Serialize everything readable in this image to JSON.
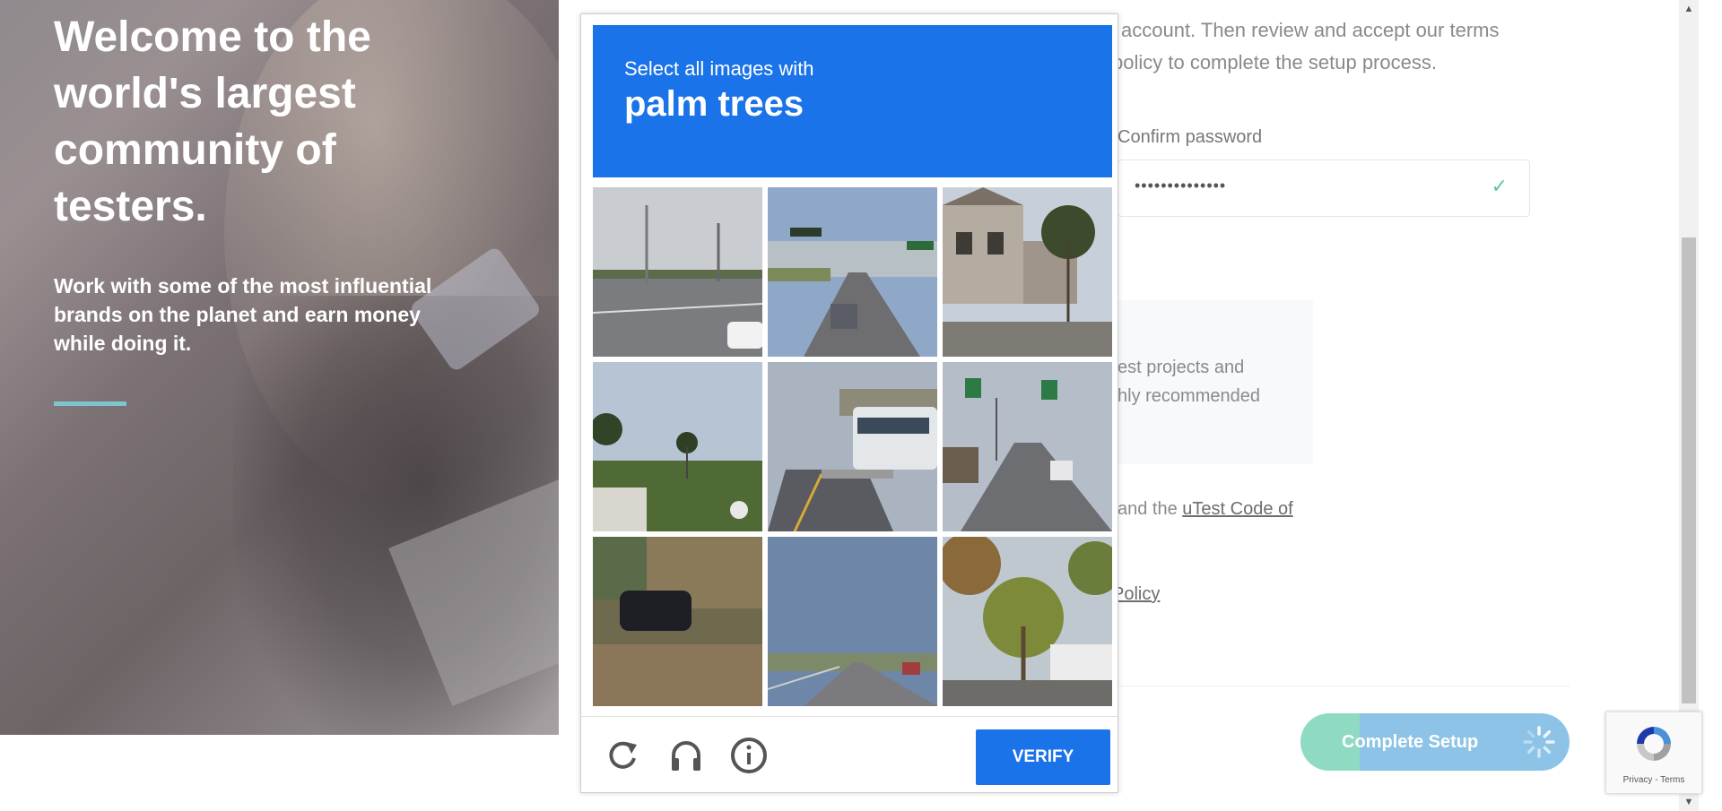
{
  "hero": {
    "title": "Welcome to the world's largest community of testers.",
    "subtitle": "Work with some of the most influential brands on the planet and earn money while doing it."
  },
  "form": {
    "intro_line1": "account. Then review and accept our terms",
    "intro_line2": "policy to complete the setup process.",
    "confirm_label": "Confirm password",
    "confirm_value": "••••••••••••••",
    "info_line1": "est projects and",
    "info_line2": "hly recommended",
    "terms_prefix": "and the",
    "terms_link": "uTest Code of",
    "policy_link": "Policy",
    "complete_button": "Complete Setup"
  },
  "captcha": {
    "instruction": "Select all images with",
    "target": "palm trees",
    "verify_button": "VERIFY",
    "footer_icons": [
      "reload-icon",
      "audio-icon",
      "info-icon"
    ]
  },
  "recaptcha_badge": {
    "links": "Privacy - Terms"
  },
  "colors": {
    "captcha_blue": "#1a73e8",
    "check_green": "#5cc7a4",
    "hero_accent": "#7fc3cf"
  }
}
